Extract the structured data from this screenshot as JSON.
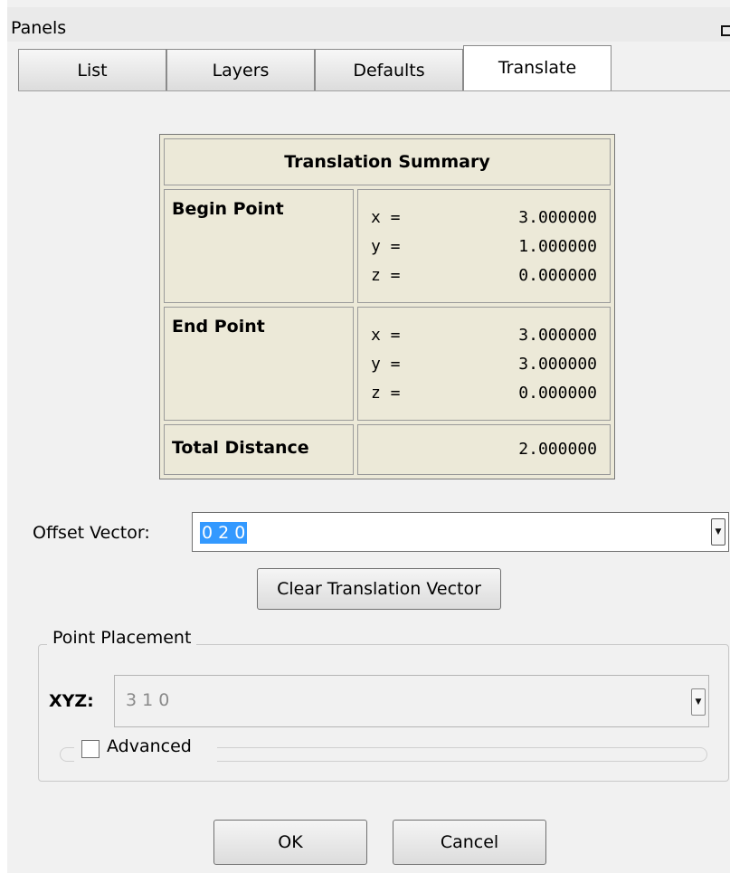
{
  "panel": {
    "title": "Panels",
    "tabs": [
      {
        "label": "List"
      },
      {
        "label": "Layers"
      },
      {
        "label": "Defaults"
      },
      {
        "label": "Translate"
      }
    ],
    "active_tab": "Translate"
  },
  "summary": {
    "title": "Translation Summary",
    "begin_point": {
      "label": "Begin Point",
      "rows": [
        {
          "axis": "x =",
          "value": "3.000000"
        },
        {
          "axis": "y =",
          "value": "1.000000"
        },
        {
          "axis": "z =",
          "value": "0.000000"
        }
      ]
    },
    "end_point": {
      "label": "End Point",
      "rows": [
        {
          "axis": "x =",
          "value": "3.000000"
        },
        {
          "axis": "y =",
          "value": "3.000000"
        },
        {
          "axis": "z =",
          "value": "0.000000"
        }
      ]
    },
    "total_distance": {
      "label": "Total Distance",
      "value": "2.000000"
    }
  },
  "offset": {
    "label": "Offset Vector:",
    "value": "0 2 0"
  },
  "clear_button": "Clear Translation Vector",
  "point_placement": {
    "title": "Point Placement",
    "xyz_label": "XYZ:",
    "xyz_value": "3 1 0",
    "advanced_label": "Advanced",
    "advanced_checked": false
  },
  "ok_button": "OK",
  "cancel_button": "Cancel"
}
